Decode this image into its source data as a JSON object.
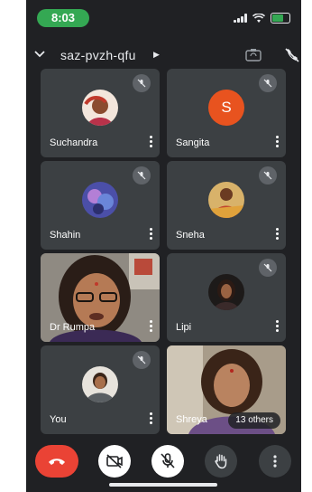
{
  "status_bar": {
    "time": "8:03"
  },
  "meeting": {
    "code": "saz-pvzh-qfu"
  },
  "participants": [
    {
      "name": "Suchandra",
      "muted": true,
      "avatar": "photo"
    },
    {
      "name": "Sangita",
      "muted": true,
      "avatar_letter": "S"
    },
    {
      "name": "Shahin",
      "muted": true,
      "avatar": "photo"
    },
    {
      "name": "Sneha",
      "muted": true,
      "avatar": "photo"
    },
    {
      "name": "Dr Rumpa",
      "muted": false,
      "avatar": "video"
    },
    {
      "name": "Lipi",
      "muted": true,
      "avatar": "photo"
    },
    {
      "name": "You",
      "muted": true,
      "avatar": "photo"
    },
    {
      "name": "Shreya",
      "muted": false,
      "avatar": "video",
      "others": "13 others"
    }
  ],
  "controls": {
    "icons": [
      "hang-up-icon",
      "camera-off-icon",
      "mic-off-icon",
      "raise-hand-icon",
      "more-options-icon"
    ]
  },
  "colors": {
    "background": "#202124",
    "tile": "#3c4043",
    "hangup": "#ea4335",
    "avatar_s": "#e8531f",
    "status_pill": "#34a853"
  }
}
